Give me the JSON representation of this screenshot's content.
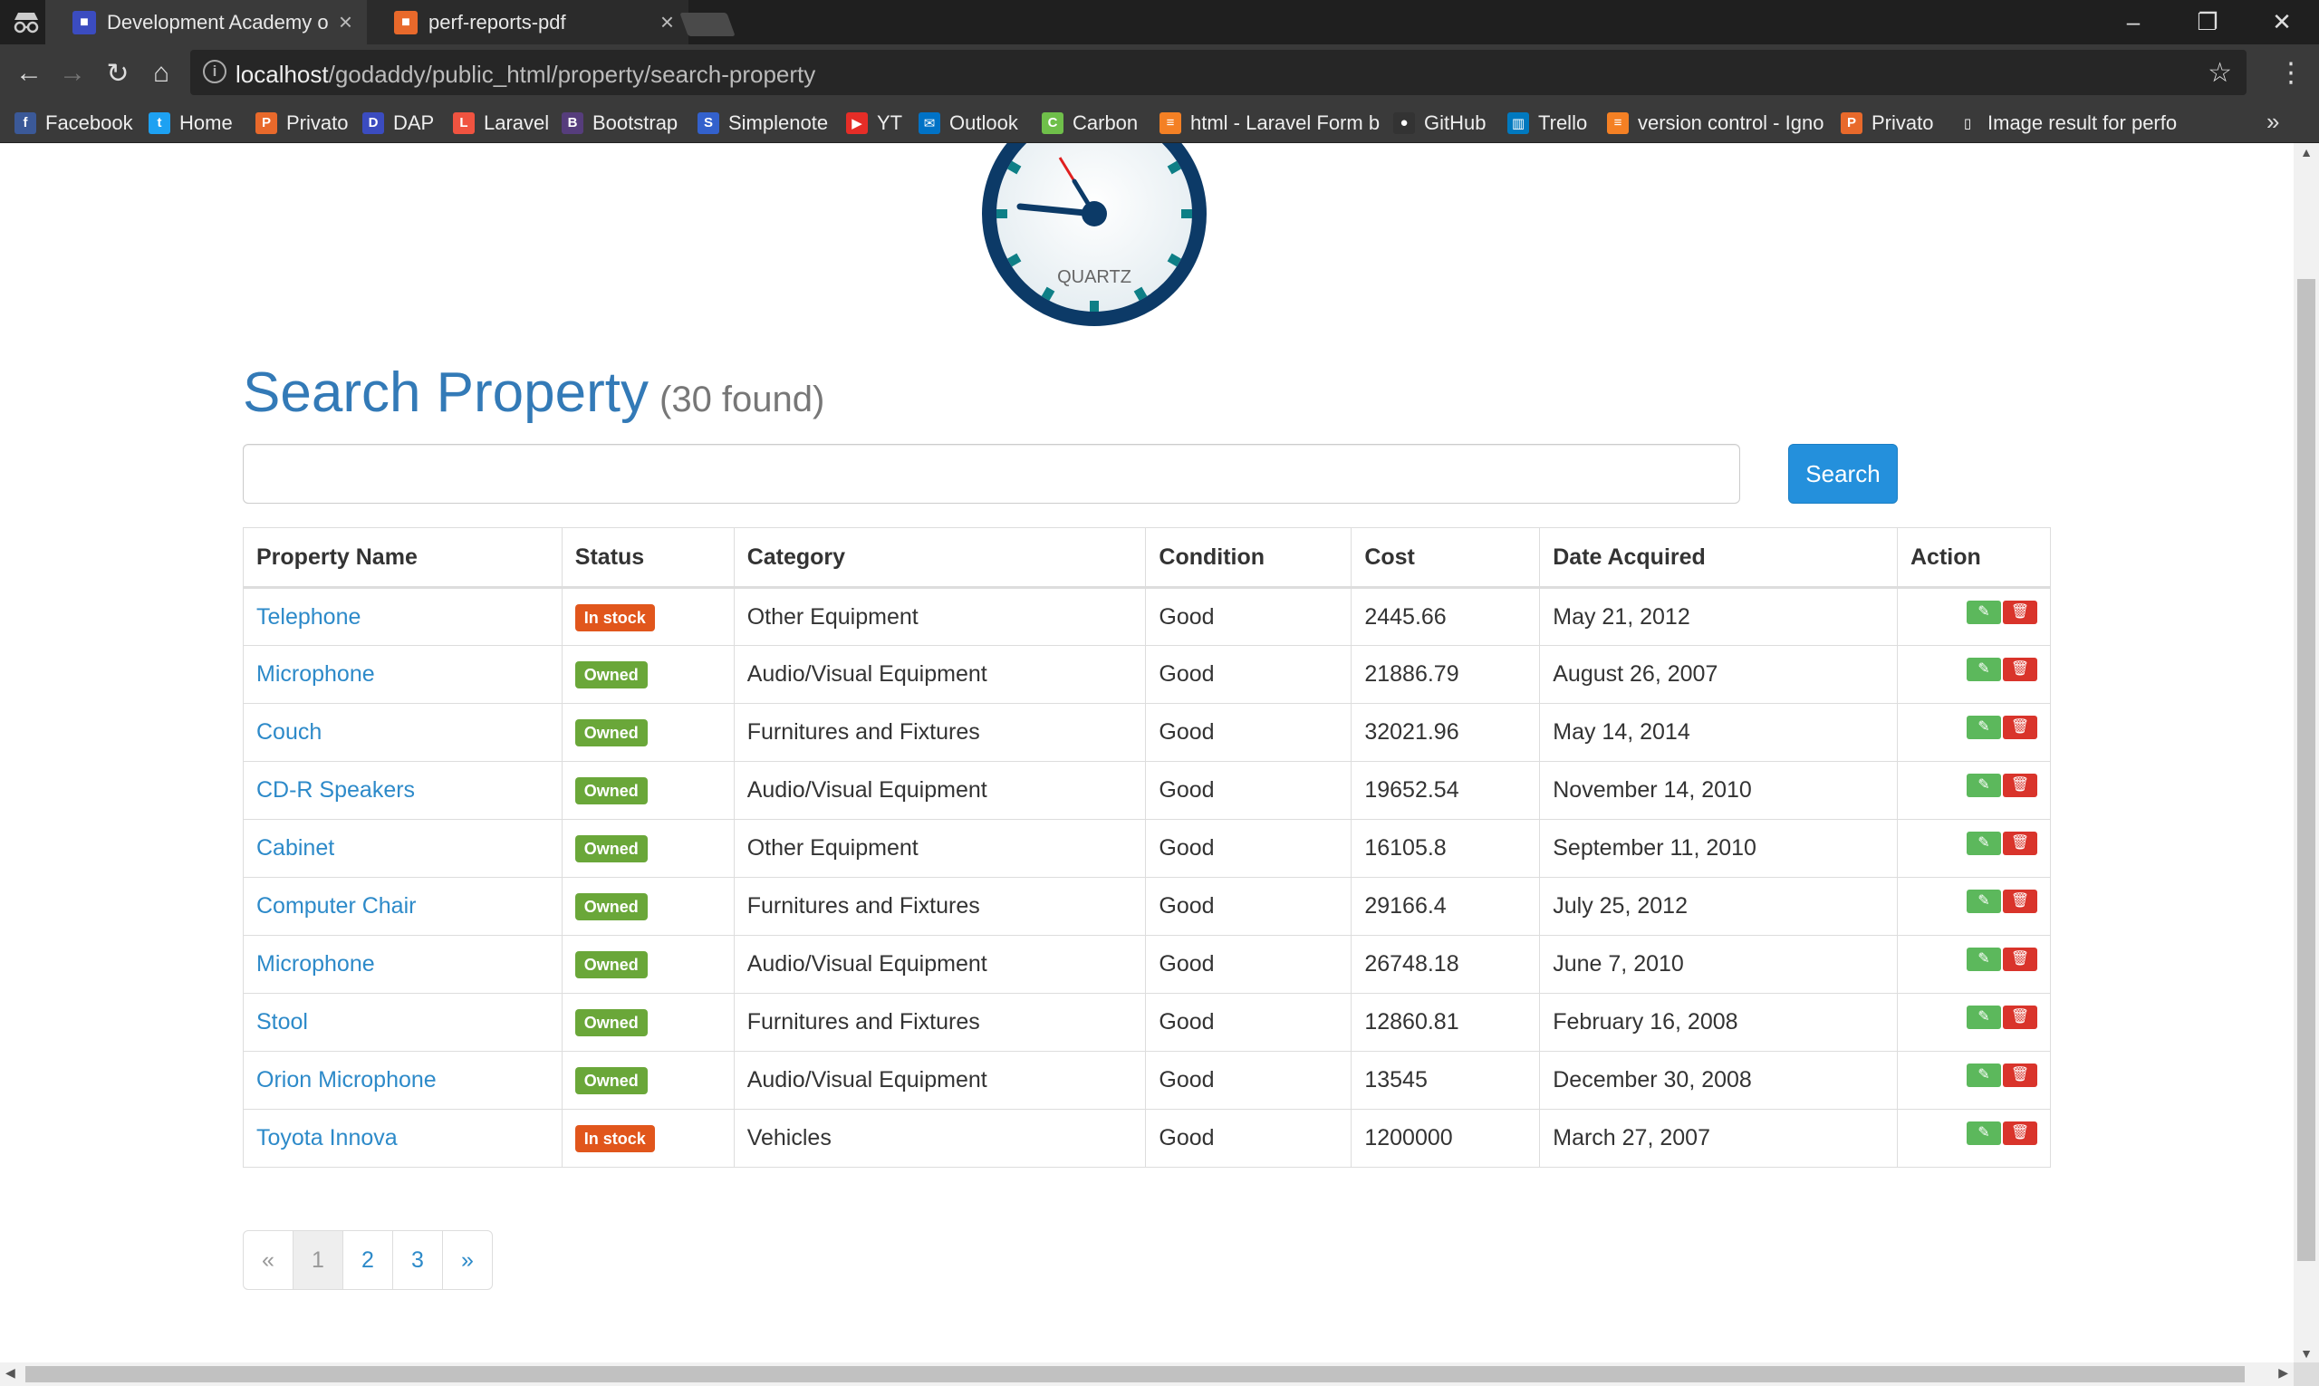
{
  "browser": {
    "tabs": [
      {
        "title": "Development Academy o",
        "favicon_color": "#3b4cc0",
        "active": true
      },
      {
        "title": "perf-reports-pdf",
        "favicon_color": "#e8692b",
        "active": false
      }
    ],
    "url_host": "localhost",
    "url_path": "/godaddy/public_html/property/search-property",
    "bookmarks": [
      {
        "label": "Facebook",
        "icon": "facebook-icon",
        "glyph": "f",
        "color": "#3b5998"
      },
      {
        "label": "Home",
        "icon": "twitter-icon",
        "glyph": "t",
        "color": "#1da1f2"
      },
      {
        "label": "Privato",
        "icon": "privato-icon",
        "glyph": "P",
        "color": "#e8692b"
      },
      {
        "label": "DAP",
        "icon": "dap-icon",
        "glyph": "D",
        "color": "#3b4cc0"
      },
      {
        "label": "Laravel",
        "icon": "laravel-icon",
        "glyph": "L",
        "color": "#f05340"
      },
      {
        "label": "Bootstrap",
        "icon": "bootstrap-icon",
        "glyph": "B",
        "color": "#563d7c"
      },
      {
        "label": "Simplenote",
        "icon": "simplenote-icon",
        "glyph": "S",
        "color": "#3361cc"
      },
      {
        "label": "YT",
        "icon": "youtube-icon",
        "glyph": "▶",
        "color": "#e52d27"
      },
      {
        "label": "Outlook",
        "icon": "outlook-icon",
        "glyph": "✉",
        "color": "#0072c6"
      },
      {
        "label": "Carbon",
        "icon": "carbon-icon",
        "glyph": "C",
        "color": "#6fbf4a"
      },
      {
        "label": "html - Laravel Form b",
        "icon": "stackoverflow-icon",
        "glyph": "≡",
        "color": "#f48024"
      },
      {
        "label": "GitHub",
        "icon": "github-icon",
        "glyph": "●",
        "color": "#333333"
      },
      {
        "label": "Trello",
        "icon": "trello-icon",
        "glyph": "▥",
        "color": "#0079bf"
      },
      {
        "label": "version control - Igno",
        "icon": "stackoverflow-icon",
        "glyph": "≡",
        "color": "#f48024"
      },
      {
        "label": "Privato",
        "icon": "privato-icon",
        "glyph": "P",
        "color": "#e8692b"
      },
      {
        "label": "Image result for perfo",
        "icon": "page-icon",
        "glyph": "▯",
        "color": "#3a3a3a"
      }
    ]
  },
  "clock": {
    "brand": "QUARTZ"
  },
  "page": {
    "title": "Search Property",
    "found": "(30 found)",
    "search_placeholder": "",
    "search_button": "Search"
  },
  "table": {
    "headers": [
      "Property Name",
      "Status",
      "Category",
      "Condition",
      "Cost",
      "Date Acquired",
      "Action"
    ],
    "rows": [
      {
        "name": "Telephone",
        "status": "In stock",
        "status_color": "#e1561c",
        "category": "Other Equipment",
        "condition": "Good",
        "cost": "2445.66",
        "date": "May 21, 2012"
      },
      {
        "name": "Microphone",
        "status": "Owned",
        "status_color": "#6aa739",
        "category": "Audio/Visual Equipment",
        "condition": "Good",
        "cost": "21886.79",
        "date": "August 26, 2007"
      },
      {
        "name": "Couch",
        "status": "Owned",
        "status_color": "#6aa739",
        "category": "Furnitures and Fixtures",
        "condition": "Good",
        "cost": "32021.96",
        "date": "May 14, 2014"
      },
      {
        "name": "CD-R Speakers",
        "status": "Owned",
        "status_color": "#6aa739",
        "category": "Audio/Visual Equipment",
        "condition": "Good",
        "cost": "19652.54",
        "date": "November 14, 2010"
      },
      {
        "name": "Cabinet",
        "status": "Owned",
        "status_color": "#6aa739",
        "category": "Other Equipment",
        "condition": "Good",
        "cost": "16105.8",
        "date": "September 11, 2010"
      },
      {
        "name": "Computer Chair",
        "status": "Owned",
        "status_color": "#6aa739",
        "category": "Furnitures and Fixtures",
        "condition": "Good",
        "cost": "29166.4",
        "date": "July 25, 2012"
      },
      {
        "name": "Microphone",
        "status": "Owned",
        "status_color": "#6aa739",
        "category": "Audio/Visual Equipment",
        "condition": "Good",
        "cost": "26748.18",
        "date": "June 7, 2010"
      },
      {
        "name": "Stool",
        "status": "Owned",
        "status_color": "#6aa739",
        "category": "Furnitures and Fixtures",
        "condition": "Good",
        "cost": "12860.81",
        "date": "February 16, 2008"
      },
      {
        "name": "Orion Microphone",
        "status": "Owned",
        "status_color": "#6aa739",
        "category": "Audio/Visual Equipment",
        "condition": "Good",
        "cost": "13545",
        "date": "December 30, 2008"
      },
      {
        "name": "Toyota Innova",
        "status": "In stock",
        "status_color": "#e1561c",
        "category": "Vehicles",
        "condition": "Good",
        "cost": "1200000",
        "date": "March 27, 2007"
      }
    ],
    "action_icons": {
      "edit": "edit-icon",
      "delete": "trash-icon"
    }
  },
  "pagination": {
    "prev": "«",
    "pages": [
      "1",
      "2",
      "3"
    ],
    "current": "1",
    "next": "»"
  },
  "colors": {
    "link": "#2d8ac9",
    "title": "#337ab7",
    "search_button": "#2490dc",
    "edit": "#5cb85c",
    "delete": "#d9342b"
  }
}
